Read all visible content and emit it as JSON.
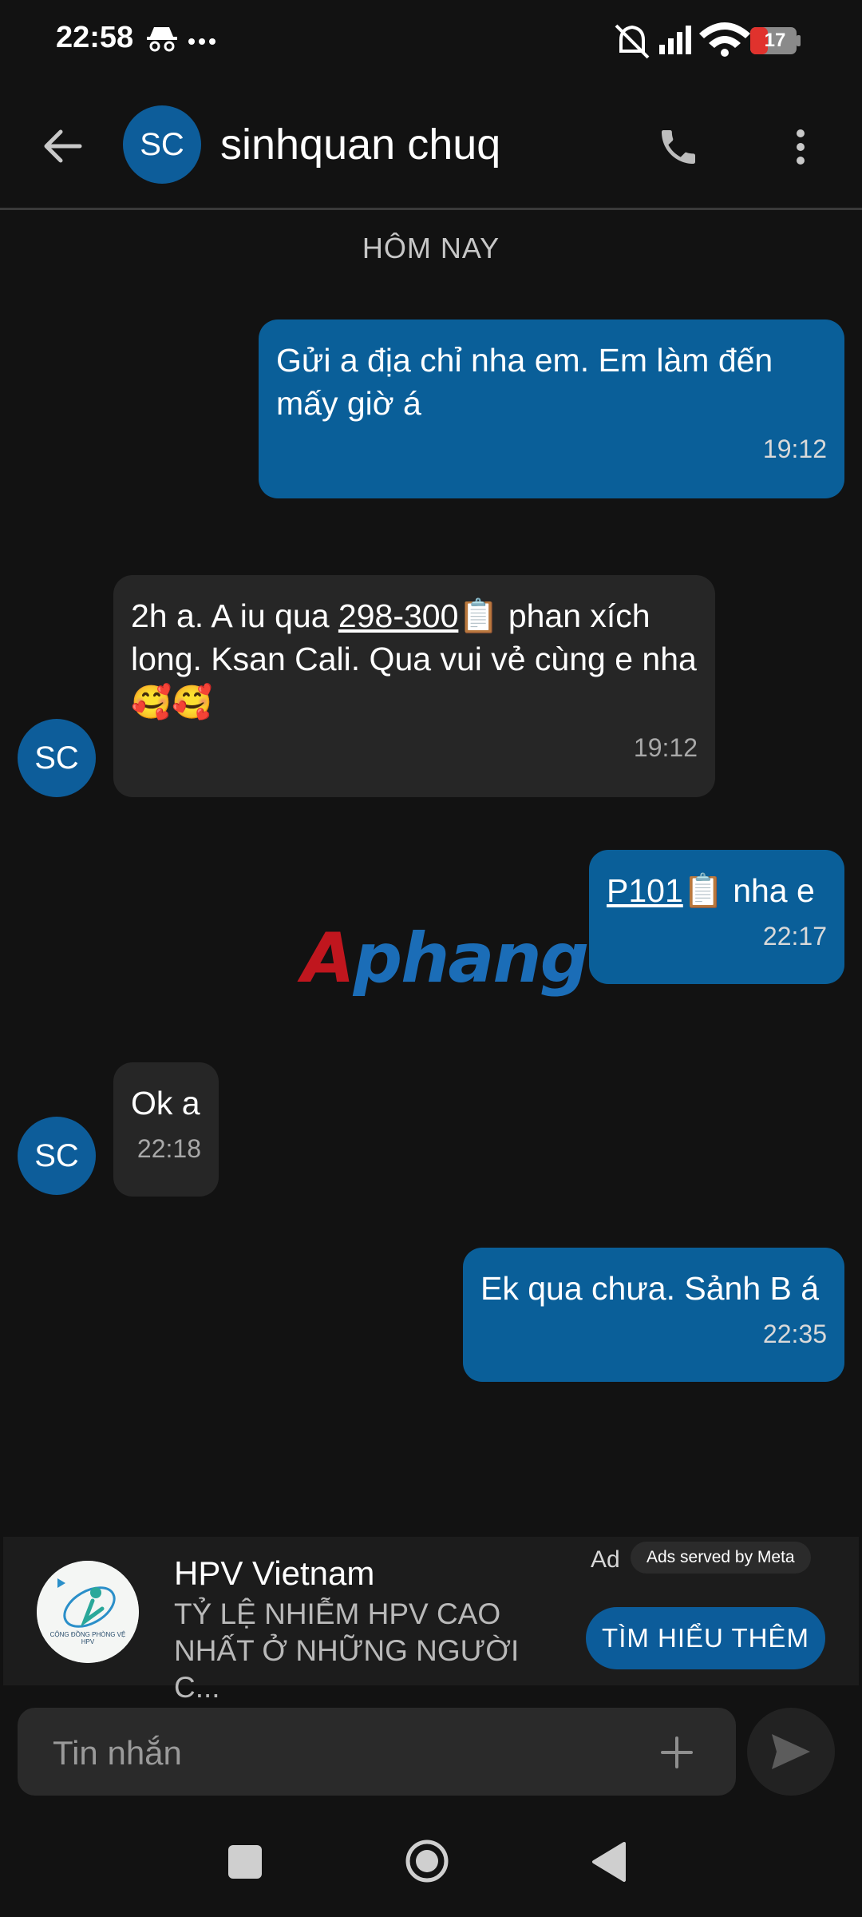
{
  "status_bar": {
    "time": "22:58",
    "battery": "17",
    "icons": [
      "incognito-icon",
      "more-dots-icon",
      "mute-bell-icon",
      "signal-icon",
      "wifi-icon",
      "battery-icon"
    ]
  },
  "app_bar": {
    "avatar_initials": "SC",
    "contact_name": "sinhquan chuq"
  },
  "date_label": "HÔM NAY",
  "messages": [
    {
      "direction": "outgoing",
      "text": "Gửi a địa chỉ nha em. Em làm đến mấy giờ á",
      "time": "19:12"
    },
    {
      "direction": "incoming",
      "text_before": "2h a. A iu qua ",
      "link": "298-300",
      "text_after": "📋 phan xích long. Ksan Cali. Qua vui vẻ cùng e nha 🥰🥰",
      "time": "19:12",
      "avatar": "SC"
    },
    {
      "direction": "outgoing",
      "link": "P101",
      "text_after": "📋 nha e",
      "time": "22:17"
    },
    {
      "direction": "incoming",
      "text": "Ok a",
      "time": "22:18",
      "avatar": "SC"
    },
    {
      "direction": "outgoing",
      "text": "Ek qua chưa. Sảnh B á",
      "time": "22:35"
    }
  ],
  "watermark": {
    "first": "A",
    "rest": "phang"
  },
  "ad": {
    "title": "HPV Vietnam",
    "body": "TỶ LỆ NHIỄM HPV CAO NHẤT Ở NHỮNG NGƯỜI C...",
    "tag": "Ad",
    "served_by": "Ads served by Meta",
    "cta": "TÌM HIỂU THÊM",
    "logo_text": "CỘNG ĐỒNG PHÒNG VỆ HPV"
  },
  "composer": {
    "placeholder": "Tin nhắn"
  },
  "colors": {
    "background": "#121212",
    "outgoing_bubble": "#0a5f99",
    "incoming_bubble": "#262626",
    "avatar": "#0d5d9a"
  }
}
